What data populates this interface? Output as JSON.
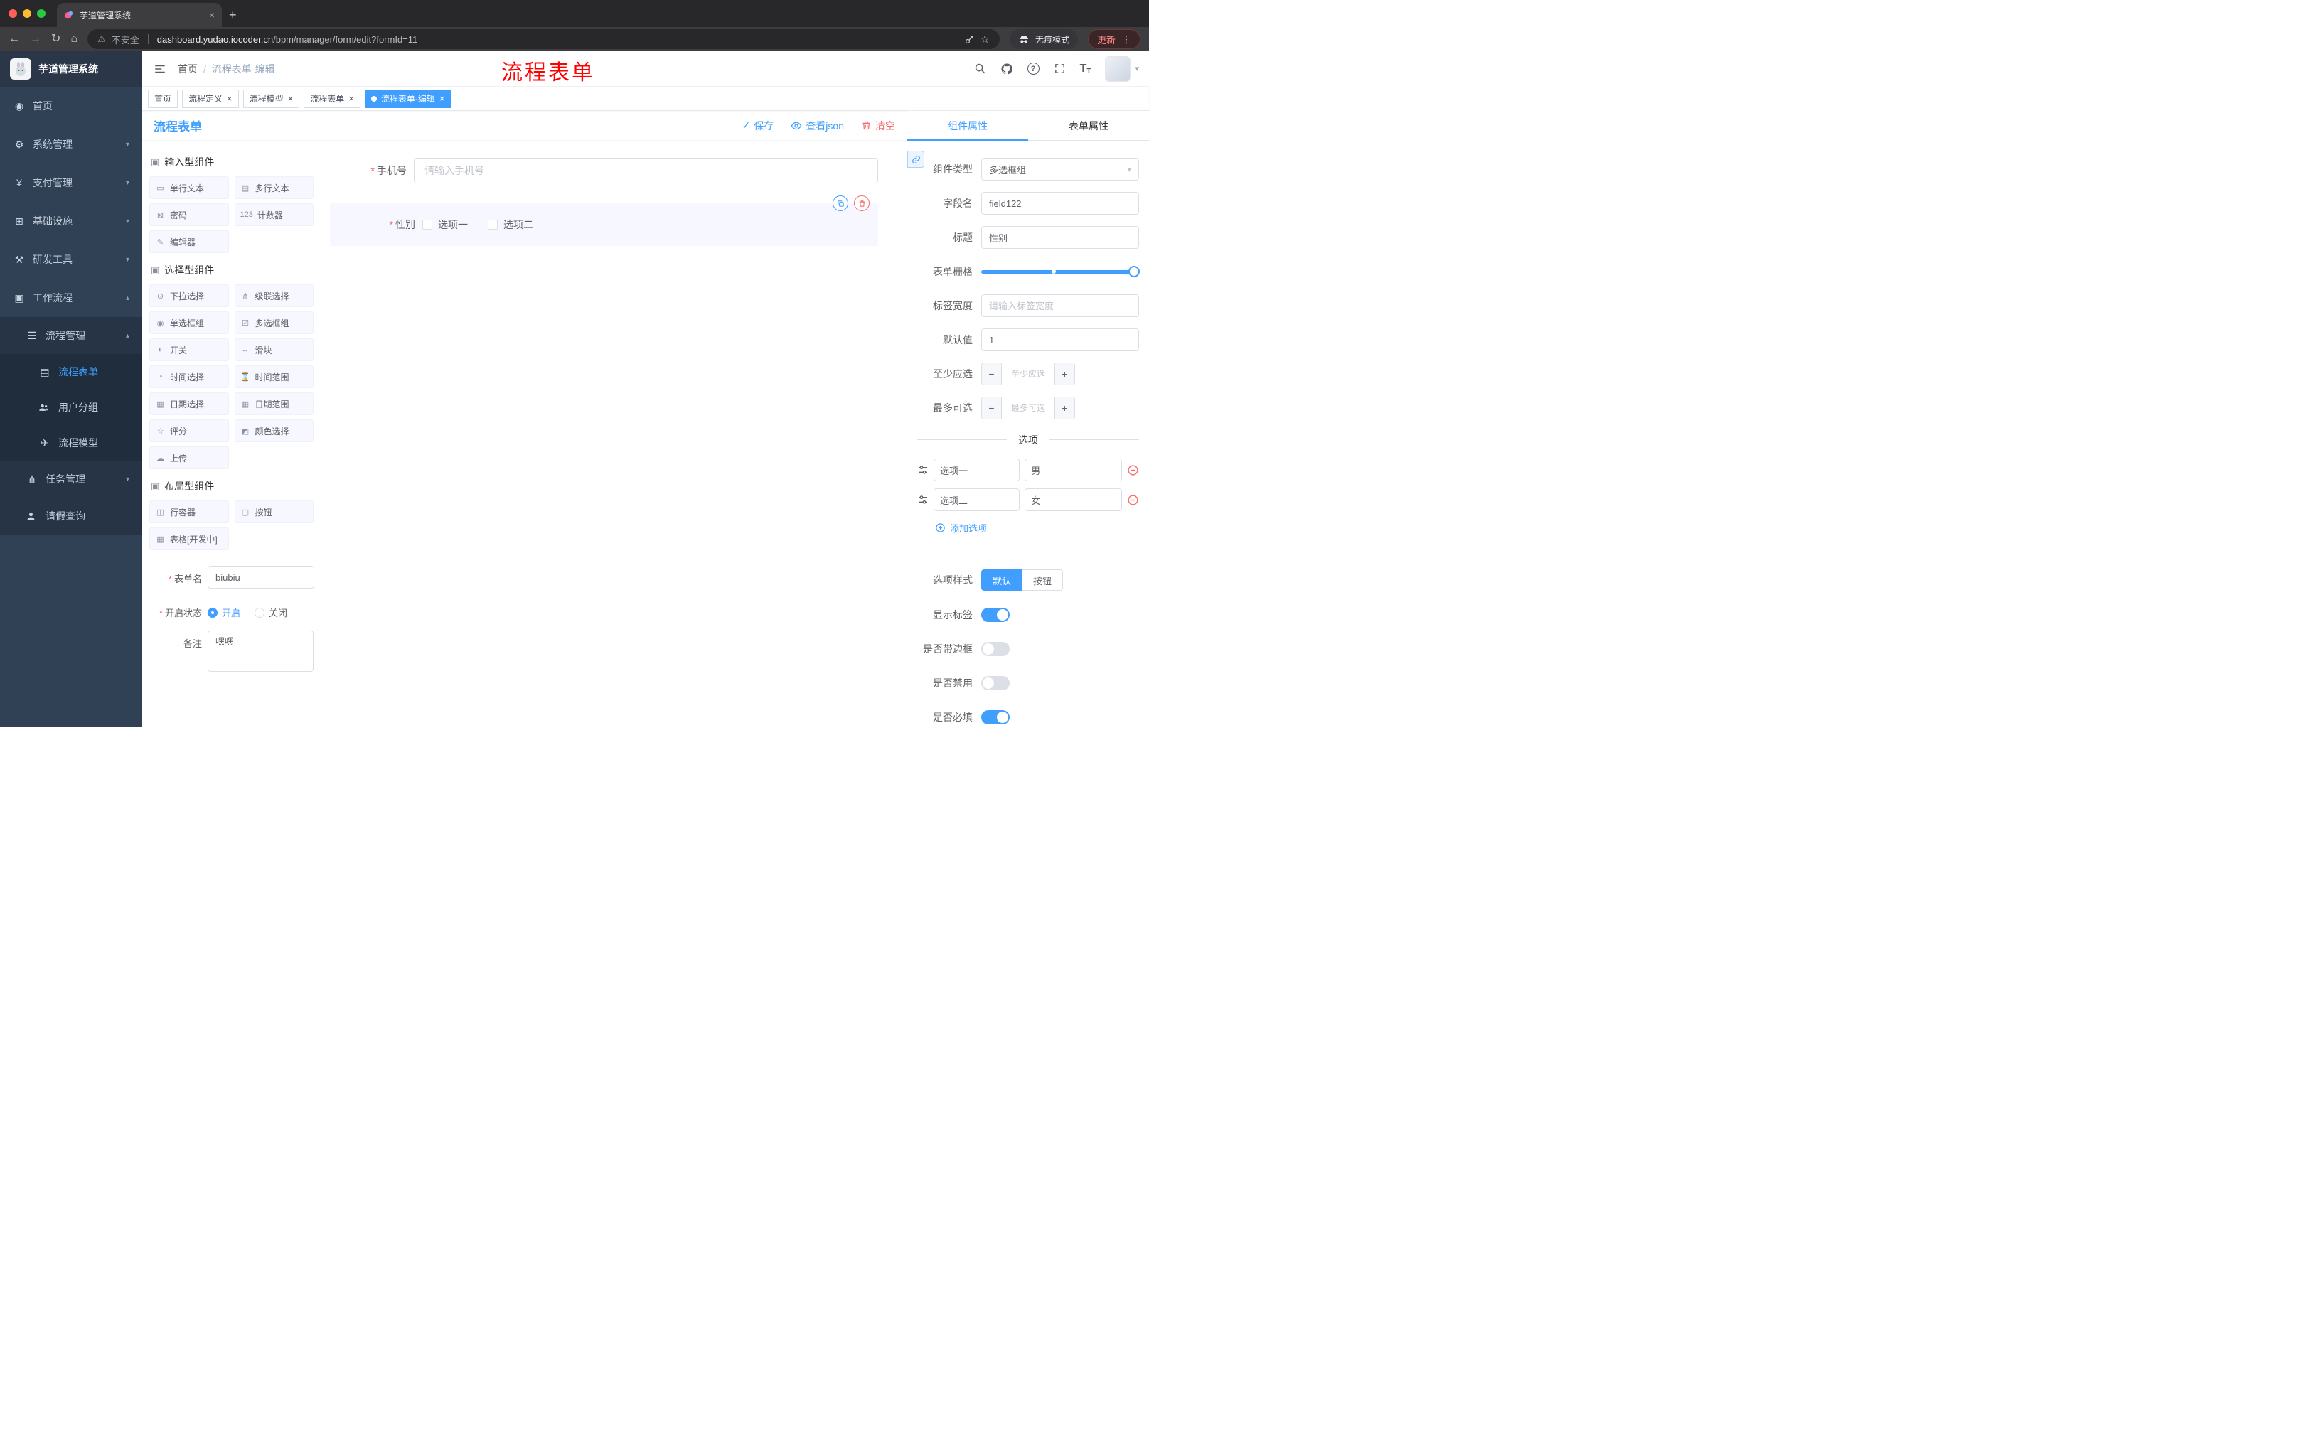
{
  "browser": {
    "tab_title": "芋道管理系统",
    "security_label": "不安全",
    "url_host": "dashboard.yudao.iocoder.cn",
    "url_path": "/bpm/manager/form/edit?formId=11",
    "incognito_label": "无痕模式",
    "update_label": "更新"
  },
  "glyphs": {
    "close": "×",
    "plus": "+",
    "minus": "−",
    "dots_vertical": "⋮",
    "caret_down": "▾",
    "chevron_up": "▴",
    "chevron_down": "▾",
    "star": "☆",
    "warning": "⚠",
    "back_arrow": "←",
    "forward_arrow": "→",
    "reload": "↻",
    "home": "⌂",
    "check": "✓",
    "slash": "/",
    "asterisk": "*",
    "question": "?",
    "font_large": "T",
    "font_small": "T",
    "menu_dashboard": "◉",
    "menu_gear": "⚙",
    "menu_yen": "¥",
    "menu_infra": "⊞",
    "menu_tools": "⚒",
    "menu_workflow": "▣",
    "menu_list": "☰",
    "menu_doc": "▤",
    "menu_plane": "✈",
    "menu_branch": "⋔"
  },
  "sidebar": {
    "logo_title": "芋道管理系统",
    "menu": [
      {
        "icon": "dashboard-icon",
        "label": "首页"
      },
      {
        "icon": "gear-icon",
        "label": "系统管理"
      },
      {
        "icon": "yen-icon",
        "label": "支付管理"
      },
      {
        "icon": "infrastructure-icon",
        "label": "基础设施"
      },
      {
        "icon": "tools-icon",
        "label": "研发工具"
      },
      {
        "icon": "workflow-icon",
        "label": "工作流程"
      },
      {
        "icon": "list-icon",
        "label": "流程管理"
      },
      {
        "icon": "document-icon",
        "label": "流程表单"
      },
      {
        "icon": "user-group-icon",
        "label": "用户分组"
      },
      {
        "icon": "paper-plane-icon",
        "label": "流程模型"
      },
      {
        "icon": "branch-icon",
        "label": "任务管理"
      },
      {
        "icon": "person-icon",
        "label": "请假查询"
      }
    ]
  },
  "header": {
    "breadcrumb_home": "首页",
    "breadcrumb_current": "流程表单-编辑",
    "annotation": "流程表单"
  },
  "tags": [
    {
      "label": "首页"
    },
    {
      "label": "流程定义"
    },
    {
      "label": "流程模型"
    },
    {
      "label": "流程表单"
    },
    {
      "label": "流程表单-编辑"
    }
  ],
  "designer": {
    "title": "流程表单",
    "actions": {
      "save": "保存",
      "view_json": "查看json",
      "clear": "清空"
    },
    "groups": [
      {
        "icon": "▣",
        "title": "输入型组件",
        "items": [
          {
            "icon": "▭",
            "label": "单行文本"
          },
          {
            "icon": "▤",
            "label": "多行文本"
          },
          {
            "icon": "⊠",
            "label": "密码"
          },
          {
            "icon": "123",
            "label": "计数器"
          },
          {
            "icon": "✎",
            "label": "编辑器"
          }
        ]
      },
      {
        "icon": "▣",
        "title": "选择型组件",
        "items": [
          {
            "icon": "⊙",
            "label": "下拉选择"
          },
          {
            "icon": "⋔",
            "label": "级联选择"
          },
          {
            "icon": "◉",
            "label": "单选框组"
          },
          {
            "icon": "☑",
            "label": "多选框组"
          },
          {
            "icon": "◐",
            "label": "开关"
          },
          {
            "icon": "↔",
            "label": "滑块"
          },
          {
            "icon": "◔",
            "label": "时间选择"
          },
          {
            "icon": "⌛",
            "label": "时间范围"
          },
          {
            "icon": "▦",
            "label": "日期选择"
          },
          {
            "icon": "▦",
            "label": "日期范围"
          },
          {
            "icon": "☆",
            "label": "评分"
          },
          {
            "icon": "◩",
            "label": "颜色选择"
          },
          {
            "icon": "☁",
            "label": "上传"
          }
        ]
      },
      {
        "icon": "▣",
        "title": "布局型组件",
        "items": [
          {
            "icon": "◫",
            "label": "行容器"
          },
          {
            "icon": "▢",
            "label": "按钮"
          },
          {
            "icon": "▦",
            "label": "表格[开发中]"
          }
        ]
      }
    ],
    "meta": {
      "form_name_label": "表单名",
      "form_name_value": "biubiu",
      "status_label": "开启状态",
      "status_on": "开启",
      "status_off": "关闭",
      "remark_label": "备注",
      "remark_value": "嘿嘿"
    },
    "canvas": {
      "phone": {
        "label": "手机号",
        "placeholder": "请输入手机号"
      },
      "gender": {
        "label": "性别",
        "option1": "选项一",
        "option2": "选项二"
      }
    }
  },
  "props": {
    "tab_component": "组件属性",
    "tab_form": "表单属性",
    "component_type_label": "组件类型",
    "component_type_value": "多选框组",
    "field_name_label": "字段名",
    "field_name_value": "field122",
    "title_label": "标题",
    "title_value": "性别",
    "grid_label": "表单栅格",
    "label_width_label": "标签宽度",
    "label_width_placeholder": "请输入标签宽度",
    "default_label": "默认值",
    "default_value": "1",
    "min_label": "至少应选",
    "min_placeholder": "至少应选",
    "max_label": "最多可选",
    "max_placeholder": "最多可选",
    "options_title": "选项",
    "option_rows": [
      {
        "label": "选项一",
        "value": "男"
      },
      {
        "label": "选项二",
        "value": "女"
      }
    ],
    "add_option_label": "添加选项",
    "style_label": "选项样式",
    "style_default": "默认",
    "style_button": "按钮",
    "switch_show_label": "显示标签",
    "switch_border": "是否带边框",
    "switch_disabled": "是否禁用",
    "switch_required": "是否必填"
  },
  "colors": {
    "accent": "#409eff",
    "danger": "#f56c6c",
    "annotation": "#ff0000",
    "sidebar_bg": "#304156",
    "active_tag_bg": "#409eff"
  }
}
